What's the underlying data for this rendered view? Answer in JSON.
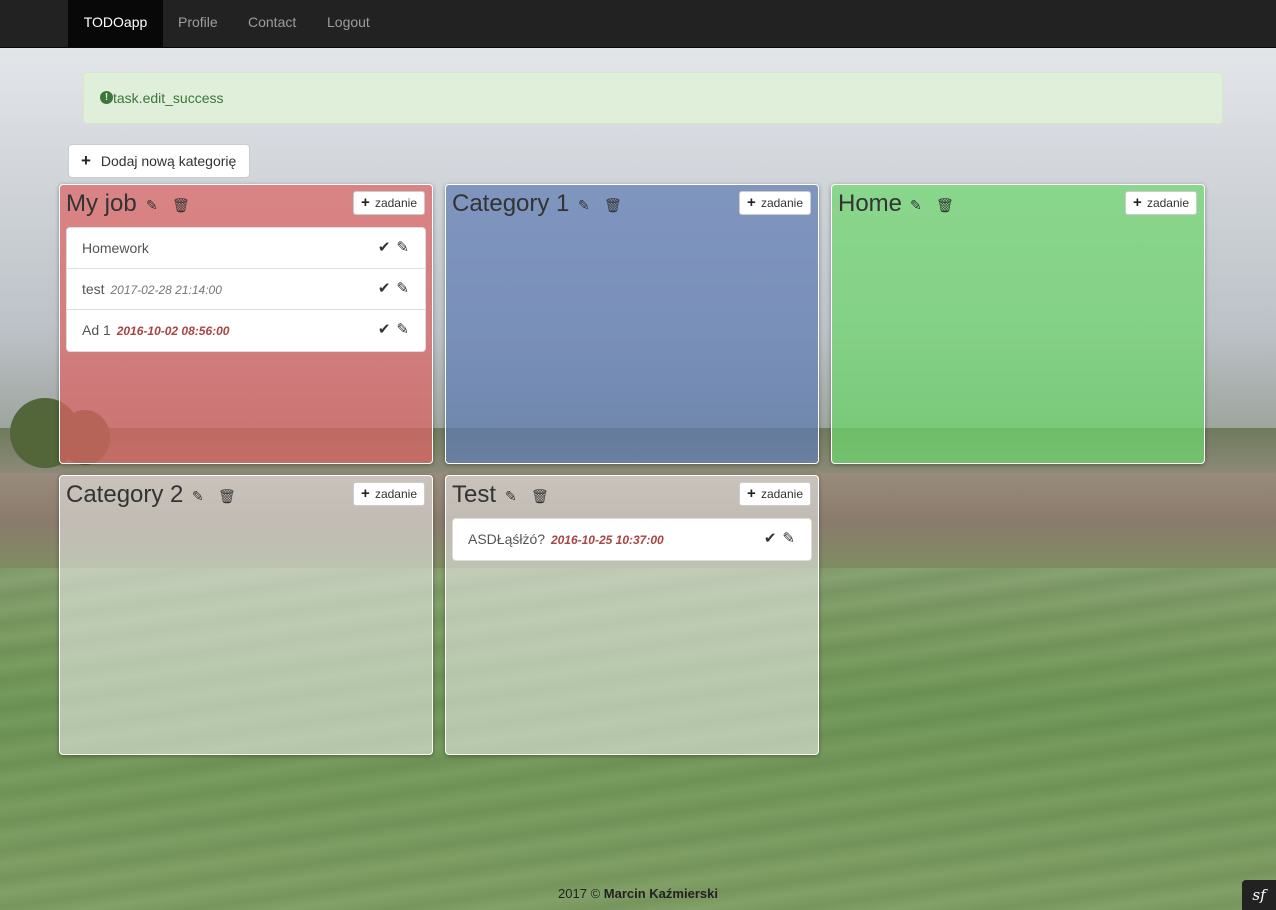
{
  "navbar": {
    "brand": "TODOapp",
    "links": [
      "Profile",
      "Contact",
      "Logout"
    ]
  },
  "alert": {
    "icon": "exclamation-sign-icon",
    "message": "task.edit_success",
    "color": "#3c763d"
  },
  "add_category_button": "Dodaj nową kategorię",
  "add_task_label": "zadanie",
  "categories": [
    {
      "title": "My job",
      "color": "#dc6464",
      "tasks": [
        {
          "name": "Homework",
          "date": "",
          "overdue": false
        },
        {
          "name": "test",
          "date": "2017-02-28 21:14:00",
          "overdue": false
        },
        {
          "name": "Ad 1",
          "date": "2016-10-02 08:56:00",
          "overdue": true
        }
      ]
    },
    {
      "title": "Category 1",
      "color": "#6e8cc8",
      "tasks": []
    },
    {
      "title": "Home",
      "color": "#78dc78",
      "tasks": []
    },
    {
      "title": "Category 2",
      "color": "#f0f0f0",
      "tasks": []
    },
    {
      "title": "Test",
      "color": "#f0f0f0",
      "tasks": [
        {
          "name": "ASDŁąśłżó?",
          "date": "2016-10-25 10:37:00",
          "overdue": true
        }
      ]
    }
  ],
  "footer": {
    "year": "2017 ©",
    "author": "Marcin Kaźmierski"
  },
  "framework_badge": "sf"
}
